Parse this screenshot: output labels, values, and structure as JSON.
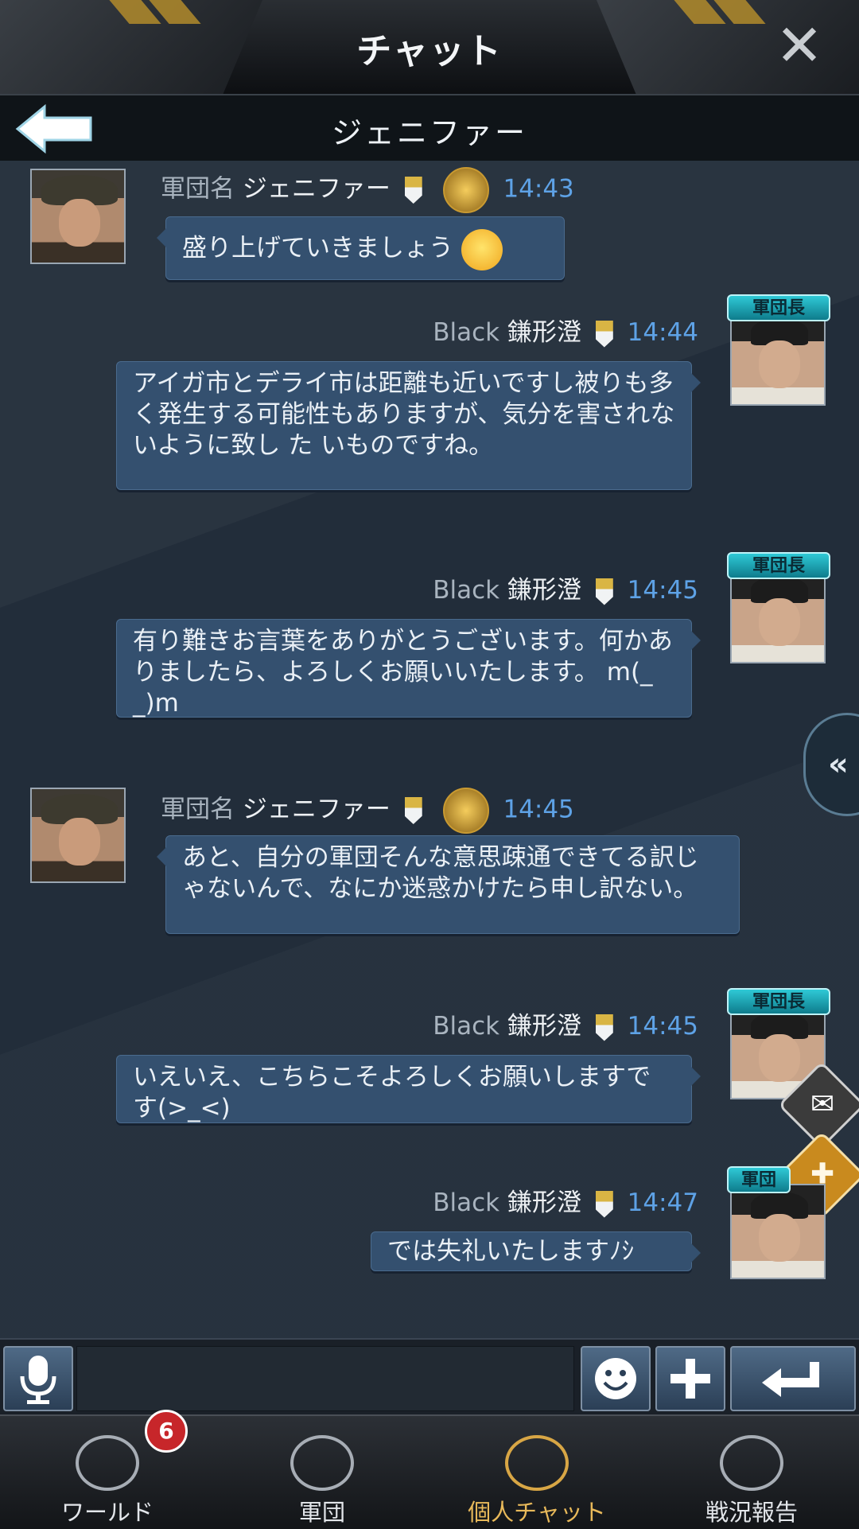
{
  "header": {
    "title": "チャット",
    "close_label": "✕"
  },
  "subheader": {
    "title": "ジェニファー"
  },
  "messages": [
    {
      "side": "left",
      "guild": "軍団名",
      "name": "ジェニファー",
      "time": "14:43",
      "text": "盛り上げていきましょう"
    },
    {
      "side": "right",
      "guild": "Black",
      "name": "鎌形澄",
      "time": "14:44",
      "leader_badge": "軍団長",
      "text": "アイガ市とデライ市は距離も近いですし被りも多く発生する可能性もありますが、気分を害されないように致し た いものですね。"
    },
    {
      "side": "right",
      "guild": "Black",
      "name": "鎌形澄",
      "time": "14:45",
      "leader_badge": "軍団長",
      "text": "有り難きお言葉をありがとうございます。何かありましたら、よろしくお願いいたします。 m(_ _)m"
    },
    {
      "side": "left",
      "guild": "軍団名",
      "name": "ジェニファー",
      "time": "14:45",
      "text": "あと、自分の軍団そんな意思疎通できてる訳じゃないんで、なにか迷惑かけたら申し訳ない。"
    },
    {
      "side": "right",
      "guild": "Black",
      "name": "鎌形澄",
      "time": "14:45",
      "leader_badge": "軍団長",
      "text": "いえいえ、こちらこそよろしくお願いしますです(>_<)"
    },
    {
      "side": "right",
      "guild": "Black",
      "name": "鎌形澄",
      "time": "14:47",
      "leader_badge": "軍団",
      "text": "では失礼いたしますﾉｼ"
    }
  ],
  "side_handle": {
    "label": "«"
  },
  "input": {
    "value": ""
  },
  "nav": [
    {
      "label": "ワールド",
      "badge": "6"
    },
    {
      "label": "軍団"
    },
    {
      "label": "個人チャット",
      "active": true
    },
    {
      "label": "戦況報告"
    }
  ],
  "colors": {
    "accent_time": "#5ea2e6",
    "bubble": "#34506f",
    "active_tab": "#e8b95a",
    "badge_red": "#c7262a"
  }
}
